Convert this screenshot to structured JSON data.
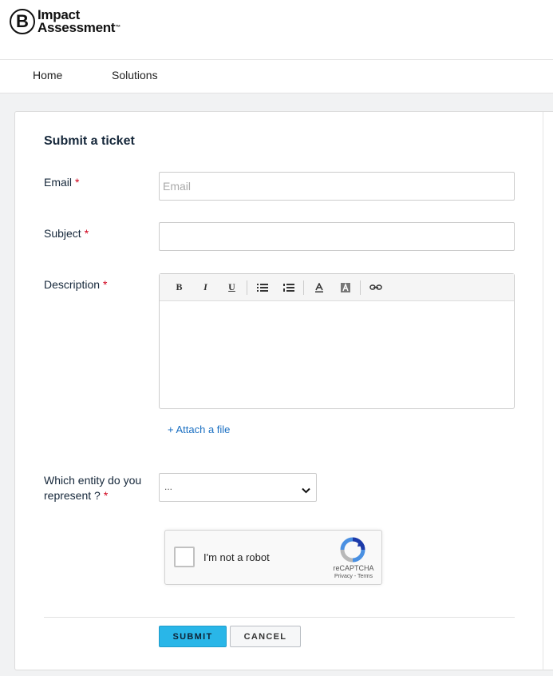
{
  "brand": {
    "logo_letter": "B",
    "name_line1": "Impact",
    "name_line2": "Assessment",
    "trademark": "™"
  },
  "nav": {
    "items": [
      {
        "label": "Home"
      },
      {
        "label": "Solutions"
      }
    ]
  },
  "form": {
    "title": "Submit a ticket",
    "required_marker": "*",
    "email": {
      "label": "Email",
      "placeholder": "Email",
      "value": ""
    },
    "subject": {
      "label": "Subject",
      "value": ""
    },
    "description": {
      "label": "Description",
      "value": "",
      "toolbar": [
        "bold-icon",
        "italic-icon",
        "underline-icon",
        "bulleted-list-icon",
        "numbered-list-icon",
        "text-color-icon",
        "background-color-icon",
        "link-icon"
      ],
      "toolbar_glyphs": {
        "bold": "B",
        "italic": "I",
        "underline": "U"
      }
    },
    "attach_label": "+ Attach a file",
    "entity": {
      "label_line1": "Which entity do you",
      "label_line2": "represent ?",
      "selected": "..."
    },
    "captcha": {
      "label": "I'm not a robot",
      "brand": "reCAPTCHA",
      "links": "Privacy - Terms",
      "checked": false
    },
    "buttons": {
      "submit": "SUBMIT",
      "cancel": "CANCEL"
    }
  },
  "colors": {
    "submit_bg": "#29b6e8",
    "link": "#1a6fc2",
    "required": "#d0021b",
    "heading": "#15273a"
  }
}
